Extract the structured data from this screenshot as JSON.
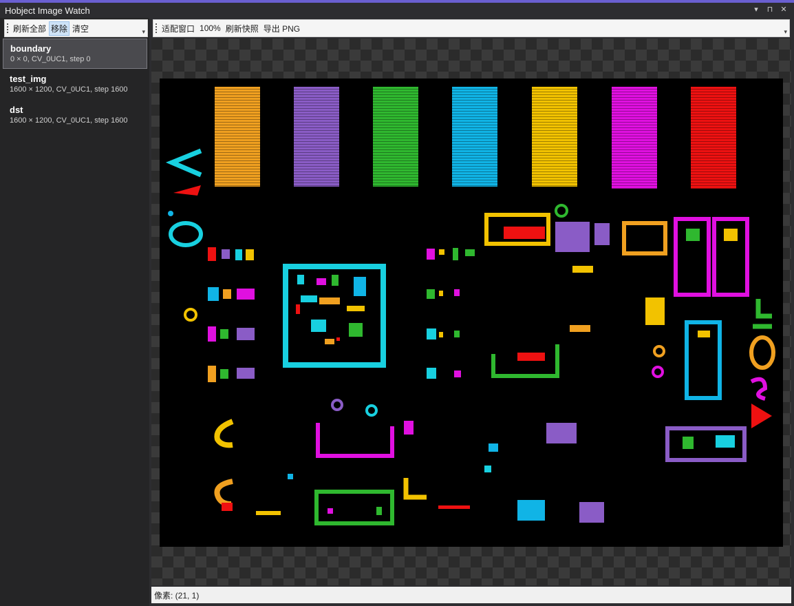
{
  "window": {
    "title": "Hobject Image Watch",
    "controls": [
      "▾",
      "⊓",
      "✕"
    ]
  },
  "left_toolbar": {
    "buttons": [
      "刷新全部",
      "移除",
      "清空"
    ]
  },
  "variables": [
    {
      "name": "boundary",
      "desc": "0 × 0, CV_0UC1, step 0"
    },
    {
      "name": "test_img",
      "desc": "1600 × 1200, CV_0UC1, step 1600"
    },
    {
      "name": "dst",
      "desc": "1600 × 1200, CV_0UC1, step 1600"
    }
  ],
  "right_toolbar": {
    "buttons": [
      "适配窗口",
      "100%",
      "刷新快照",
      "导出 PNG"
    ]
  },
  "status": {
    "pixel": "像素: (21, 1)"
  },
  "colors": {
    "orange": "#f0a020",
    "purple": "#8a5cc6",
    "green": "#2fb82f",
    "cyan": "#10b4e6",
    "yellow": "#f2c200",
    "magenta": "#e010e0",
    "red": "#ee1111",
    "teal": "#18d0e0"
  }
}
